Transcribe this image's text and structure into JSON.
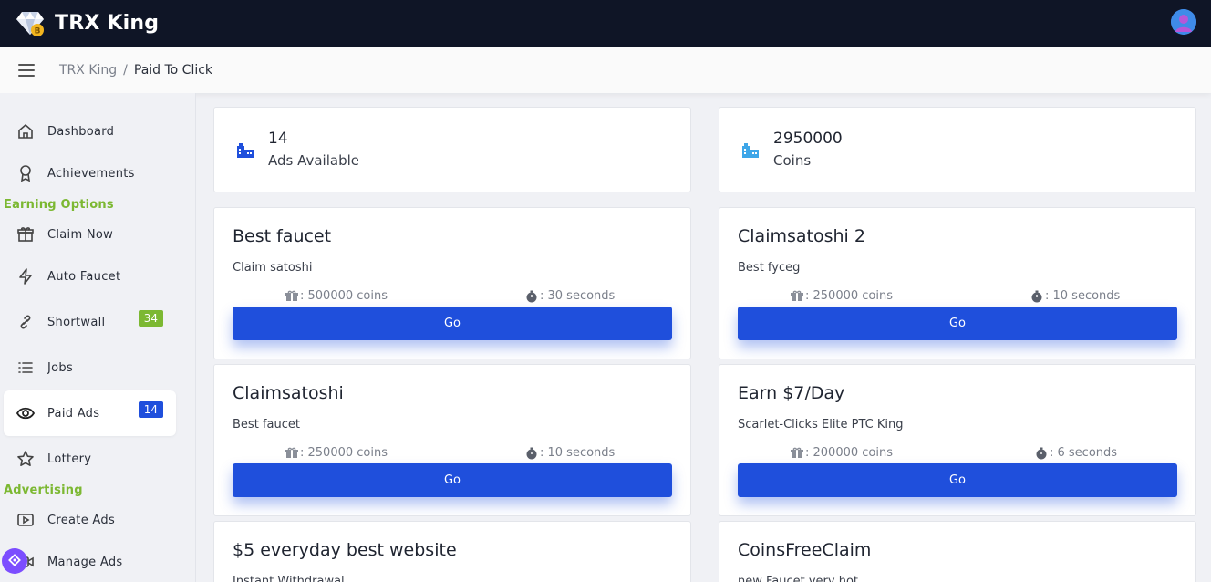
{
  "app": {
    "title": "TRX King"
  },
  "breadcrumb": {
    "home": "TRX King",
    "separator": "/",
    "current": "Paid To Click"
  },
  "sidebar": {
    "items": [
      {
        "label": "Dashboard",
        "icon": "home-icon"
      },
      {
        "label": "Achievements",
        "icon": "award-icon"
      },
      {
        "label": "Claim Now",
        "icon": "gift-icon"
      },
      {
        "label": "Auto Faucet",
        "icon": "lightning-icon"
      },
      {
        "label": "Shortwall",
        "icon": "link-icon",
        "badge": "34"
      },
      {
        "label": "Jobs",
        "icon": "list-icon"
      },
      {
        "label": "Paid Ads",
        "icon": "eye-icon",
        "badge": "14"
      },
      {
        "label": "Lottery",
        "icon": "star-icon"
      },
      {
        "label": "Create Ads",
        "icon": "play-icon"
      },
      {
        "label": "Manage Ads",
        "icon": "video-icon"
      }
    ],
    "sections": {
      "earning": "Earning Options",
      "advertising": "Advertising"
    }
  },
  "stats": {
    "ads": {
      "value": "14",
      "label": "Ads Available"
    },
    "coins": {
      "value": "2950000",
      "label": "Coins"
    }
  },
  "ads": [
    {
      "title": "Best faucet",
      "desc": "Claim satoshi",
      "reward": ": 500000 coins",
      "time": ": 30 seconds",
      "button": "Go"
    },
    {
      "title": "Claimsatoshi 2",
      "desc": "Best fyceg",
      "reward": ": 250000 coins",
      "time": ": 10 seconds",
      "button": "Go"
    },
    {
      "title": "Claimsatoshi",
      "desc": "Best faucet",
      "reward": ": 250000 coins",
      "time": ": 10 seconds",
      "button": "Go"
    },
    {
      "title": "Earn $7/Day",
      "desc": "Scarlet-Clicks Elite PTC King",
      "reward": ": 200000 coins",
      "time": ": 6 seconds",
      "button": "Go"
    },
    {
      "title": "$5 everyday best website",
      "desc": "Instant Withdrawal"
    },
    {
      "title": "CoinsFreeClaim",
      "desc": "new Faucet very hot"
    }
  ],
  "colors": {
    "topbar": "#0f1526",
    "accent": "#1f4fdc",
    "section": "#7cb832",
    "badge_green": "#7cb832",
    "badge_blue": "#1f4fdc"
  }
}
